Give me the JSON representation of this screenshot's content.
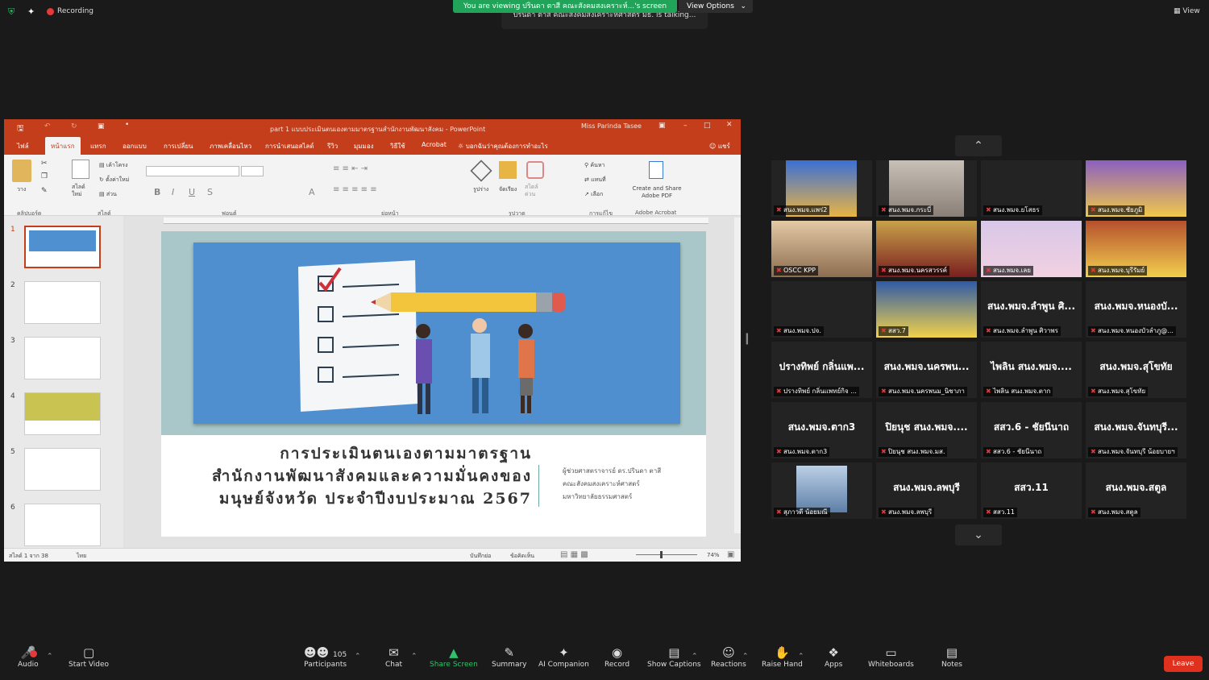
{
  "topbar": {
    "recording": "Recording",
    "share_banner": "You are viewing ปรินดา ตาสี คณะสังคมสงเคราะห์...'s screen",
    "view_options": "View Options",
    "talking": "ปรินดา ตาสี คณะสังคมสงเคราะห์ศาสตร์ มธ. is talking...",
    "view": "View"
  },
  "ppt": {
    "title": "part 1 แบบประเมินตนเองตามมาตรฐานสำนักงานพัฒนาสังคม - PowerPoint",
    "user": "Miss Parinda Tasee",
    "menu": [
      "ไฟล์",
      "หน้าแรก",
      "แทรก",
      "ออกแบบ",
      "การเปลี่ยน",
      "ภาพเคลื่อนไหว",
      "การนำเสนอสไลด์",
      "รีวิว",
      "มุมมอง",
      "วิธีใช้",
      "Acrobat",
      "บอกฉันว่าคุณต้องการทำอะไร",
      "แชร์"
    ],
    "ribbon": {
      "paste": "วาง",
      "new_slide": "สไลด์ใหม่",
      "layout": "เค้าโครง",
      "reset": "ตั้งค่าใหม่",
      "section": "ส่วน",
      "shapes": "รูปร่าง",
      "arrange": "จัดเรียง",
      "quick_styles": "สไตล์ด่วน",
      "find": "ค้นหา",
      "replace": "แทนที่",
      "select": "เลือก",
      "create_share": "Create and Share",
      "adobe_pdf": "Adobe PDF",
      "groups": [
        "คลิปบอร์ด",
        "สไลด์",
        "ฟอนต์",
        "ย่อหน้า",
        "รูปวาด",
        "การแก้ไข",
        "Adobe Acrobat"
      ]
    },
    "slide_numbers": [
      "1",
      "2",
      "3",
      "4",
      "5",
      "6"
    ],
    "slide": {
      "line1": "การประเมินตนเองตามมาตรฐาน",
      "line2": "สำนักงานพัฒนาสังคมและความมั่นคงของ",
      "line3": "มนุษย์จังหวัด ประจำปีงบประมาณ 2567",
      "author1": "ผู้ช่วยศาสตราจารย์ ดร.ปรินดา ตาสี",
      "author2": "คณะสังคมสงเคราะห์ศาสตร์",
      "author3": "มหาวิทยาลัยธรรมศาสตร์"
    },
    "status": {
      "slide_of": "สไลด์ 1 จาก 38",
      "lang": "ไทย",
      "notes": "บันทึกย่อ",
      "comments": "ข้อคิดเห็น",
      "zoom": "74%"
    }
  },
  "gallery": [
    {
      "label": "สนง.พมจ.แพร่2",
      "name": "",
      "video": "temple"
    },
    {
      "label": "สนง.พมจ.กระบี่",
      "name": "",
      "video": "hand"
    },
    {
      "label": "สนง.พมจ.ยโสธร",
      "name": "",
      "video": ""
    },
    {
      "label": "สนง.พมจ.ชัยภูมิ",
      "name": "",
      "video": "purple"
    },
    {
      "label": "OSCC KPP",
      "name": "",
      "video": "office"
    },
    {
      "label": "สนง.พมจ.นครสวรรค์",
      "name": "",
      "video": "banner"
    },
    {
      "label": "สนง.พมจ.เลย",
      "name": "",
      "video": "pink"
    },
    {
      "label": "สนง.พมจ.บุรีรัมย์",
      "name": "",
      "video": "yellow"
    },
    {
      "label": "สนง.พมจ.ปจ.",
      "name": "",
      "video": ""
    },
    {
      "label": "สสว.7",
      "name": "",
      "video": "desk"
    },
    {
      "label": "สนง.พมจ.ลำพูน ศิวาพร",
      "name": "สนง.พมจ.ลำพูน ศิ...",
      "video": ""
    },
    {
      "label": "สนง.พมจ.หนองบัวลำภู@...",
      "name": "สนง.พมจ.หนองบั...",
      "video": ""
    },
    {
      "label": "ปรางทิพย์ กลิ่นแพทย์กิจ ...",
      "name": "ปรางทิพย์ กลิ่นแพ...",
      "video": ""
    },
    {
      "label": "สนง.พมจ.นครพนม_นิชาภา",
      "name": "สนง.พมจ.นครพน...",
      "video": ""
    },
    {
      "label": "ไพลิน สนง.พมจ.ตาก",
      "name": "ไพลิน สนง.พมจ....",
      "video": ""
    },
    {
      "label": "สนง.พมจ.สุโขทัย",
      "name": "สนง.พมจ.สุโขทัย",
      "video": ""
    },
    {
      "label": "สนง.พมจ.ตาก3",
      "name": "สนง.พมจ.ตาก3",
      "video": ""
    },
    {
      "label": "ปิยนุช สนง.พมจ.มส.",
      "name": "ปิยนุช สนง.พมจ....",
      "video": ""
    },
    {
      "label": "สสว.6 - ชัยนีนาถ",
      "name": "สสว.6 - ชัยนีนาถ",
      "video": ""
    },
    {
      "label": "สนง.พมจ.จันทบุรี น้อยบายฯ",
      "name": "สนง.พมจ.จันทบุรี...",
      "video": ""
    },
    {
      "label": "สุภาวดี น้อยมณี",
      "name": "",
      "video": "woman"
    },
    {
      "label": "สนง.พมจ.ลพบุรี",
      "name": "สนง.พมจ.ลพบุรี",
      "video": ""
    },
    {
      "label": "สสว.11",
      "name": "สสว.11",
      "video": ""
    },
    {
      "label": "สนง.พมจ.สตูล",
      "name": "สนง.พมจ.สตูล",
      "video": ""
    }
  ],
  "toolbar": {
    "audio": "Audio",
    "video": "Start Video",
    "participants": "Participants",
    "participants_count": "105",
    "chat": "Chat",
    "share": "Share Screen",
    "summary": "Summary",
    "ai": "AI Companion",
    "record": "Record",
    "captions": "Show Captions",
    "reactions": "Reactions",
    "raise": "Raise Hand",
    "apps": "Apps",
    "whiteboards": "Whiteboards",
    "notes": "Notes",
    "leave": "Leave"
  }
}
